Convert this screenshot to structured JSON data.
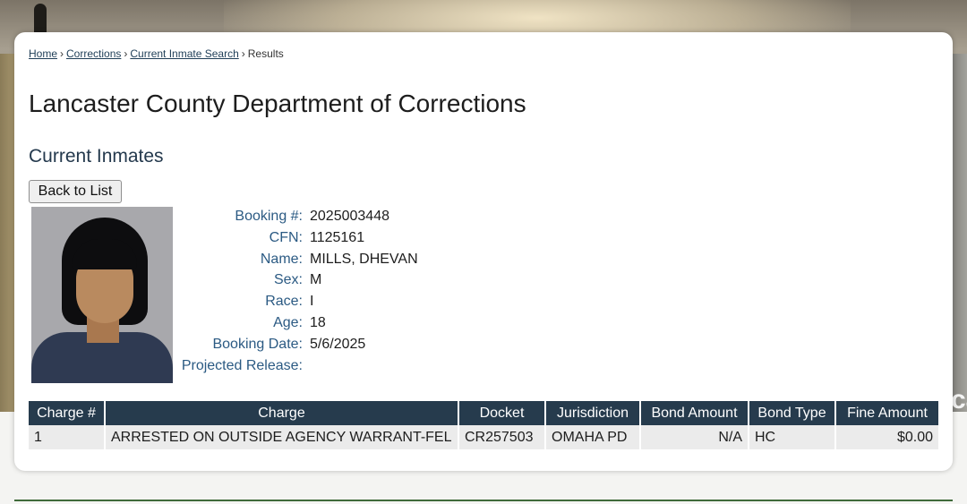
{
  "breadcrumb": {
    "home": "Home",
    "corrections": "Corrections",
    "search": "Current Inmate Search",
    "current": "Results",
    "separator": "›"
  },
  "page_title": "Lancaster County Department of Corrections",
  "section_title": "Current Inmates",
  "back_button": "Back to List",
  "inmate": {
    "labels": {
      "booking": "Booking #:",
      "cfn": "CFN:",
      "name": "Name:",
      "sex": "Sex:",
      "race": "Race:",
      "age": "Age:",
      "booking_date": "Booking Date:",
      "projected_release": "Projected Release:"
    },
    "values": {
      "booking": "2025003448",
      "cfn": "1125161",
      "name": "MILLS, DHEVAN",
      "sex": "M",
      "race": "I",
      "age": "18",
      "booking_date": "5/6/2025",
      "projected_release": ""
    }
  },
  "charges": {
    "headers": [
      "Charge #",
      "Charge",
      "Docket",
      "Jurisdiction",
      "Bond Amount",
      "Bond Type",
      "Fine Amount"
    ],
    "rows": [
      [
        "1",
        "ARRESTED ON OUTSIDE AGENCY WARRANT-FEL",
        "CR257503",
        "OMAHA PD",
        "N/A",
        "HC",
        "$0.00"
      ]
    ]
  },
  "background": {
    "corner_text": "ca"
  },
  "colors": {
    "table_header": "#263b4d",
    "label_blue": "#2b5a83",
    "footer_rule": "#3f6a3a"
  }
}
